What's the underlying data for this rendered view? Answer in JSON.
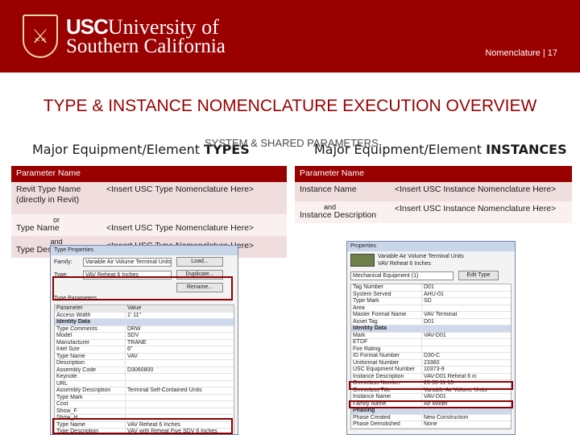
{
  "header": {
    "logo_usc": "USC",
    "logo_line1_rest": "University of",
    "logo_line2": "Southern California",
    "slide_label": "Nomenclature | 17",
    "seal_icon": "usc-shield-icon"
  },
  "title": "TYPE & INSTANCE NOMENCLATURE EXECUTION OVERVIEW",
  "subtitle": {
    "left_prefix": "Major Equipment/Element ",
    "left_bold": "TYPES",
    "center": "SYSTEM & SHARED PARAMETERS",
    "right_prefix": "Major Equipment/Element ",
    "right_bold": "INSTANCES"
  },
  "left_table": {
    "header": "Parameter Name",
    "rows": [
      {
        "name": "Revit Type Name (directly in Revit)",
        "value": "<Insert USC Type Nomenclature Here>"
      },
      {
        "name": "Type Name",
        "value": "<Insert USC Type Nomenclature Here>"
      },
      {
        "name": "Type Description",
        "value": "<Insert USC Type Nomenclature Here>"
      }
    ],
    "conj_or": "or",
    "conj_and": "and"
  },
  "right_table": {
    "header": "Parameter Name",
    "rows": [
      {
        "name": "Instance Name",
        "value": "<Insert USC Instance Nomenclature Here>"
      },
      {
        "name": "Instance Description",
        "value": "<Insert USC Instance Nomenclature Here>"
      }
    ],
    "conj_and": "and"
  },
  "type_dialog": {
    "title": "Type Properties",
    "family_label": "Family:",
    "family_value": "Variable Air Volume Terminal Units",
    "type_label": "Type:",
    "type_value": "VAV Reheat 6 Inches",
    "load_button": "Load...",
    "duplicate_button": "Duplicate...",
    "rename_button": "Rename...",
    "section": "Type Parameters",
    "col_param": "Parameter",
    "col_value": "Value",
    "rows": [
      {
        "p": "Access Width",
        "v": "1' 11\""
      },
      {
        "p": "Identity Data",
        "v": "",
        "group": true
      },
      {
        "p": "Type Comments",
        "v": "DRW"
      },
      {
        "p": "Model",
        "v": "SDV"
      },
      {
        "p": "Manufacturer",
        "v": "TRANE"
      },
      {
        "p": "Inlet Size",
        "v": "6\""
      },
      {
        "p": "Type Name",
        "v": "VAV"
      },
      {
        "p": "Description",
        "v": ""
      },
      {
        "p": "Assembly Code",
        "v": "D3060800"
      },
      {
        "p": "Keynote",
        "v": ""
      },
      {
        "p": "URL",
        "v": ""
      },
      {
        "p": "Assembly Description",
        "v": "Terminal Self-Contained Units"
      },
      {
        "p": "Type Mark",
        "v": ""
      },
      {
        "p": "Cost",
        "v": ""
      },
      {
        "p": "Show_F",
        "v": ""
      },
      {
        "p": "Show_H",
        "v": ""
      },
      {
        "p": "Type Name",
        "v": "VAV Reheat 6 Inches"
      },
      {
        "p": "Type Description",
        "v": "VAV with Reheat Five SDV 6 Inches"
      }
    ]
  },
  "instance_dialog": {
    "title": "Properties",
    "family_line1": "Variable Air Volume Terminal Units",
    "family_line2": "VAV Reheat 6 Inches",
    "filter_value": "Mechanical Equipment (1)",
    "edit_type": "Edit Type",
    "rows": [
      {
        "p": "Tag Number",
        "v": "D01"
      },
      {
        "p": "System Served",
        "v": "AHU-01"
      },
      {
        "p": "Type Mark",
        "v": "SD"
      },
      {
        "p": "Area",
        "v": ""
      },
      {
        "p": "Master Format Name",
        "v": "VAV Terminal"
      },
      {
        "p": "Asset Tag",
        "v": "D01"
      },
      {
        "p": "Identity Data",
        "v": "",
        "group": true
      },
      {
        "p": "Mark",
        "v": "VAV-D01"
      },
      {
        "p": "ETDF",
        "v": ""
      },
      {
        "p": "Fire Rating",
        "v": ""
      },
      {
        "p": "ID Format Number",
        "v": "D30-C"
      },
      {
        "p": "Uniformat Number",
        "v": "23360"
      },
      {
        "p": "USC Equipment Number",
        "v": "10373-9"
      },
      {
        "p": "Instance Description",
        "v": "VAV-D01 Reheat 6 in"
      },
      {
        "p": "Omniclass Number",
        "v": "23-33 11 13"
      },
      {
        "p": "Omniclass Title",
        "v": "Variable Air Volume Units"
      },
      {
        "p": "Instance Name",
        "v": "VAV-D01"
      },
      {
        "p": "Family Name",
        "v": "Air Model"
      },
      {
        "p": "Phasing",
        "v": "",
        "group": true
      },
      {
        "p": "Phase Created",
        "v": "New Construction"
      },
      {
        "p": "Phase Demolished",
        "v": "None"
      }
    ]
  }
}
